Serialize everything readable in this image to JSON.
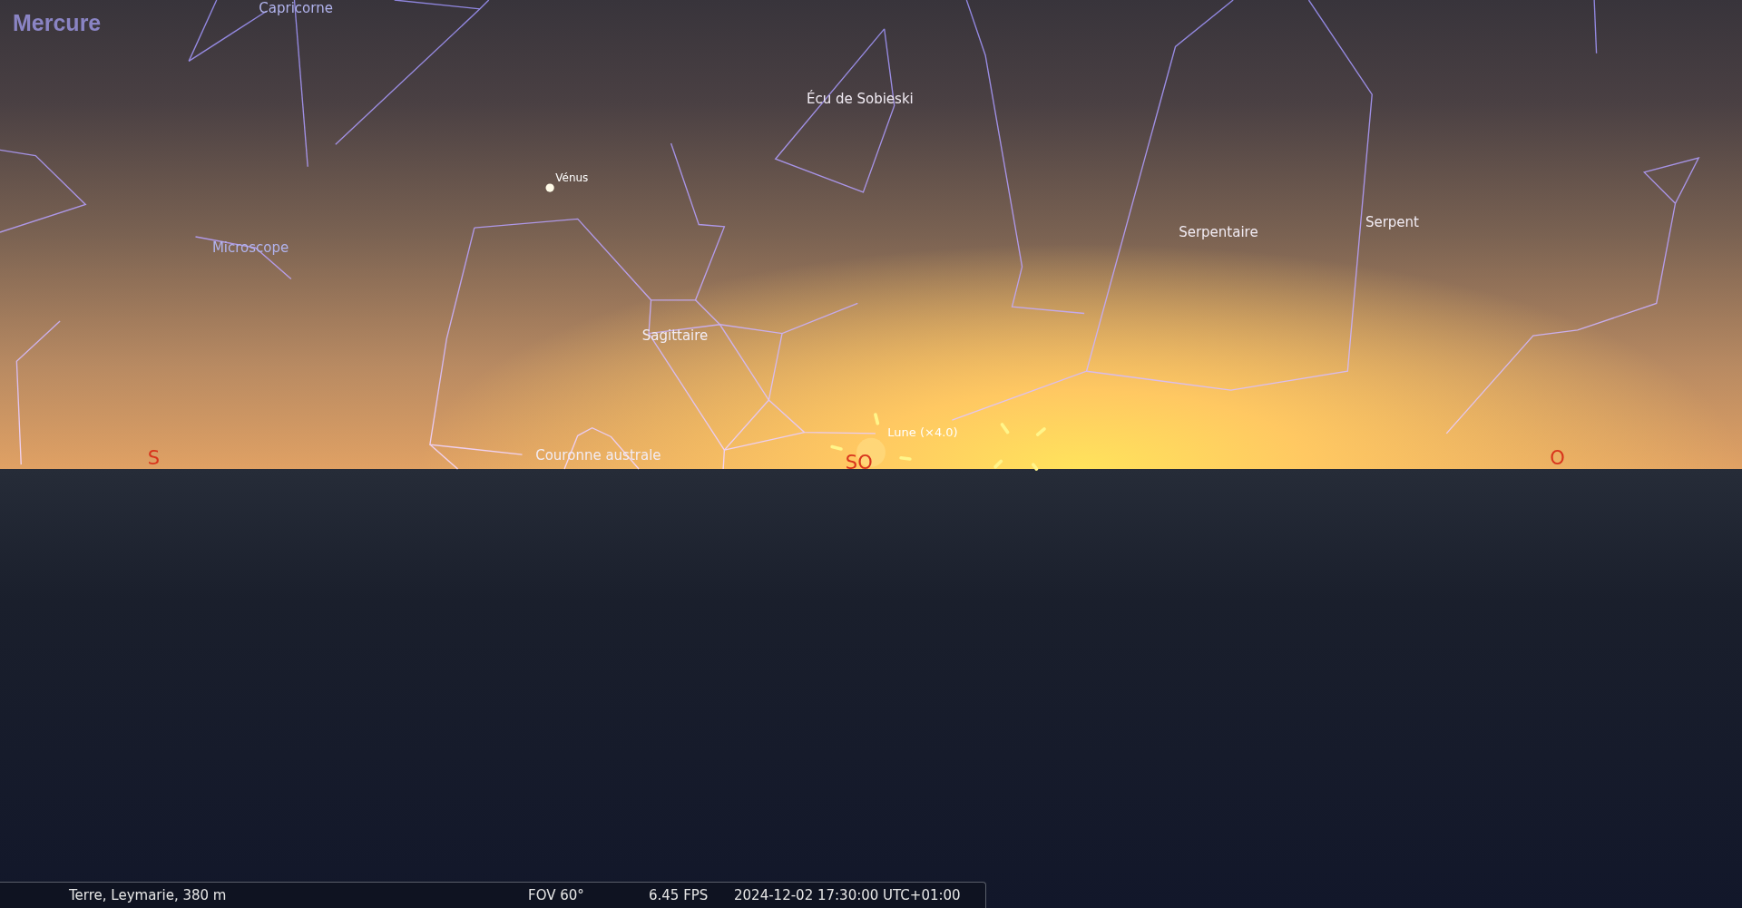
{
  "object_title": "Mercure",
  "sky_labels": [
    {
      "kind": "constellation",
      "text": "Capricorne"
    },
    {
      "kind": "constellation",
      "text": "Écu de Sobieski"
    },
    {
      "kind": "planet",
      "text": "Vénus"
    },
    {
      "kind": "constellation",
      "text": "Microscope"
    },
    {
      "kind": "constellation",
      "text": "Serpentaire"
    },
    {
      "kind": "constellation",
      "text": "Serpent"
    },
    {
      "kind": "constellation",
      "text": "Sagittaire"
    },
    {
      "kind": "moon",
      "text": "Lune (×4.0)"
    },
    {
      "kind": "cardinal",
      "text": "S"
    },
    {
      "kind": "constellation",
      "text": "Couronne australe"
    },
    {
      "kind": "cardinal",
      "text": "SO"
    },
    {
      "kind": "cardinal",
      "text": "O"
    }
  ],
  "status_bar": {
    "location": "Terre, Leymarie, 380 m",
    "fov": "FOV 60°",
    "fps": "6.45 FPS",
    "datetime": "2024-12-02 17:30:00 UTC+01:00"
  }
}
